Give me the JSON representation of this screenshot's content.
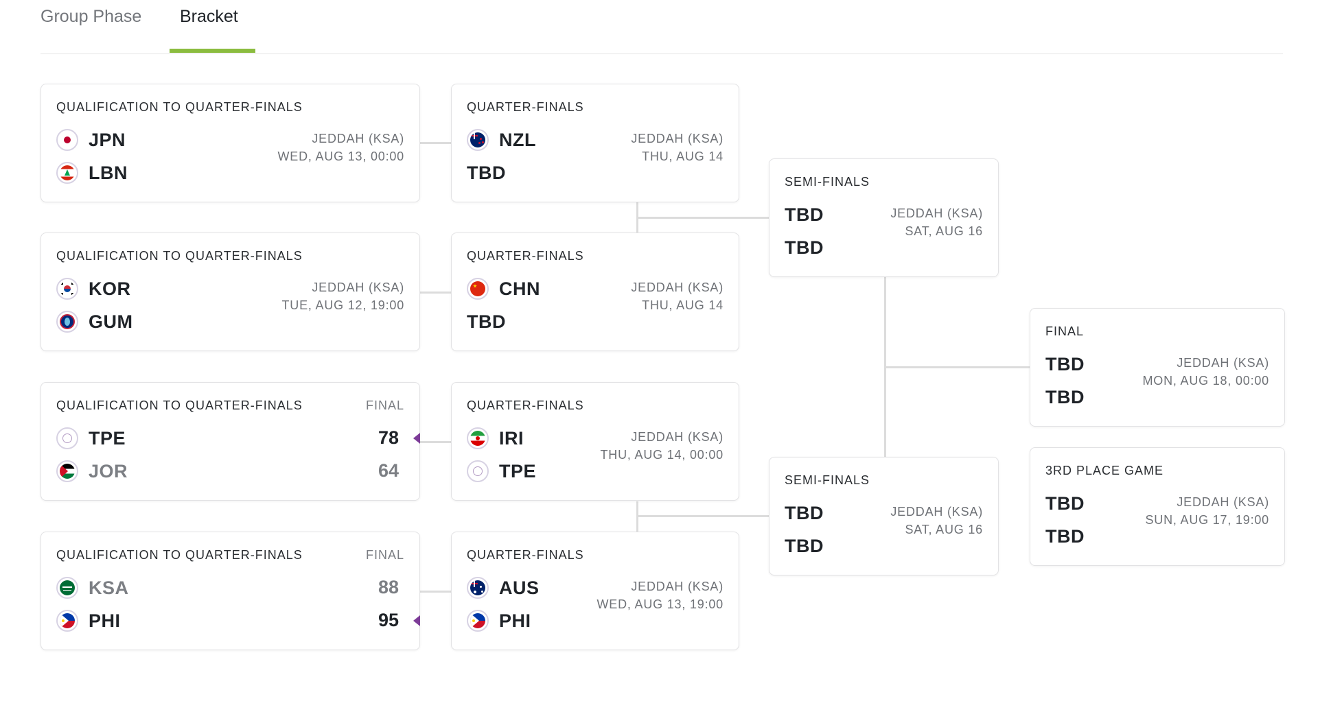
{
  "tabs": [
    {
      "label": "Group Phase",
      "active": false
    },
    {
      "label": "Bracket",
      "active": true
    }
  ],
  "accent_color": "#8bbc3f",
  "winner_marker_color": "#7d3c98",
  "qualification": [
    {
      "title": "QUALIFICATION TO QUARTER-FINALS",
      "status": "",
      "venue": "JEDDAH (KSA)",
      "date": "WED, AUG 13, 00:00",
      "teams": [
        {
          "code": "JPN",
          "flag": "japan-flag-icon",
          "score": ""
        },
        {
          "code": "LBN",
          "flag": "lebanon-flag-icon",
          "score": ""
        }
      ]
    },
    {
      "title": "QUALIFICATION TO QUARTER-FINALS",
      "status": "",
      "venue": "JEDDAH (KSA)",
      "date": "TUE, AUG 12, 19:00",
      "teams": [
        {
          "code": "KOR",
          "flag": "korea-flag-icon",
          "score": ""
        },
        {
          "code": "GUM",
          "flag": "guam-flag-icon",
          "score": ""
        }
      ]
    },
    {
      "title": "QUALIFICATION TO QUARTER-FINALS",
      "status": "FINAL",
      "venue": "",
      "date": "",
      "teams": [
        {
          "code": "TPE",
          "flag": "chinese-taipei-flag-icon",
          "score": "78",
          "winner": true
        },
        {
          "code": "JOR",
          "flag": "jordan-flag-icon",
          "score": "64",
          "winner": false
        }
      ]
    },
    {
      "title": "QUALIFICATION TO QUARTER-FINALS",
      "status": "FINAL",
      "venue": "",
      "date": "",
      "teams": [
        {
          "code": "KSA",
          "flag": "saudi-arabia-flag-icon",
          "score": "88",
          "winner": false
        },
        {
          "code": "PHI",
          "flag": "philippines-flag-icon",
          "score": "95",
          "winner": true
        }
      ]
    }
  ],
  "quarterfinals": [
    {
      "title": "QUARTER-FINALS",
      "venue": "JEDDAH (KSA)",
      "date": "THU, AUG 14",
      "teams": [
        {
          "code": "NZL",
          "flag": "new-zealand-flag-icon"
        },
        {
          "code": "TBD",
          "flag": ""
        }
      ]
    },
    {
      "title": "QUARTER-FINALS",
      "venue": "JEDDAH (KSA)",
      "date": "THU, AUG 14",
      "teams": [
        {
          "code": "CHN",
          "flag": "china-flag-icon"
        },
        {
          "code": "TBD",
          "flag": ""
        }
      ]
    },
    {
      "title": "QUARTER-FINALS",
      "venue": "JEDDAH (KSA)",
      "date": "THU, AUG 14, 00:00",
      "teams": [
        {
          "code": "IRI",
          "flag": "iran-flag-icon"
        },
        {
          "code": "TPE",
          "flag": "chinese-taipei-flag-icon"
        }
      ]
    },
    {
      "title": "QUARTER-FINALS",
      "venue": "JEDDAH (KSA)",
      "date": "WED, AUG 13, 19:00",
      "teams": [
        {
          "code": "AUS",
          "flag": "australia-flag-icon"
        },
        {
          "code": "PHI",
          "flag": "philippines-flag-icon"
        }
      ]
    }
  ],
  "semifinals": [
    {
      "title": "SEMI-FINALS",
      "venue": "JEDDAH (KSA)",
      "date": "SAT, AUG 16",
      "teams": [
        {
          "code": "TBD"
        },
        {
          "code": "TBD"
        }
      ]
    },
    {
      "title": "SEMI-FINALS",
      "venue": "JEDDAH (KSA)",
      "date": "SAT, AUG 16",
      "teams": [
        {
          "code": "TBD"
        },
        {
          "code": "TBD"
        }
      ]
    }
  ],
  "final": {
    "title": "FINAL",
    "venue": "JEDDAH (KSA)",
    "date": "MON, AUG 18, 00:00",
    "teams": [
      {
        "code": "TBD"
      },
      {
        "code": "TBD"
      }
    ]
  },
  "third_place": {
    "title": "3RD PLACE GAME",
    "venue": "JEDDAH (KSA)",
    "date": "SUN, AUG 17, 19:00",
    "teams": [
      {
        "code": "TBD"
      },
      {
        "code": "TBD"
      }
    ]
  }
}
